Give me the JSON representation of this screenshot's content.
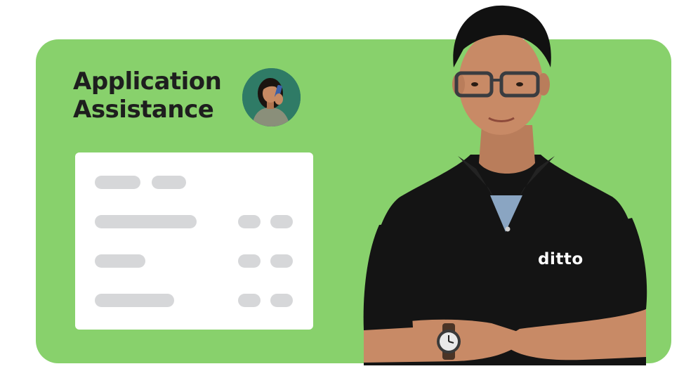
{
  "heading": {
    "line1": "Application",
    "line2": "Assistance"
  },
  "brand": {
    "shirt_logo": "ditto"
  },
  "colors": {
    "card_background": "#88d16c",
    "heading_text": "#1e1e1e",
    "placeholder_bar": "#d6d7d9",
    "shirt": "#141414"
  },
  "icons": {
    "avatar": "woman-on-phone-avatar",
    "watch": "wristwatch"
  }
}
